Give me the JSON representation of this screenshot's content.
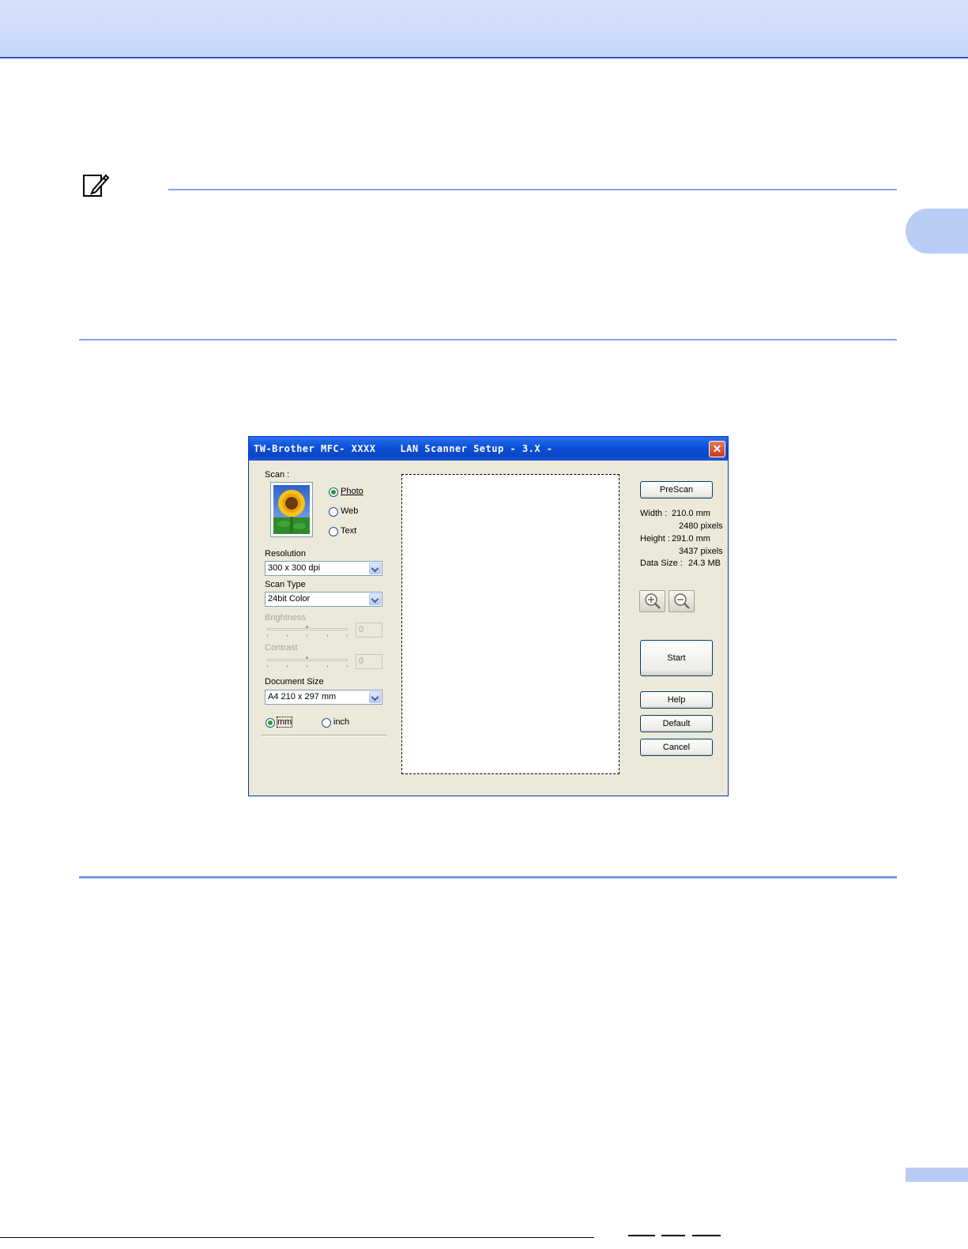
{
  "dialog": {
    "title": "TW-Brother MFC- XXXX    LAN Scanner Setup - 3.X -",
    "close_label": "✕",
    "scan": {
      "label": "Scan :",
      "options": [
        "Photo",
        "Web",
        "Text"
      ],
      "selected": "Photo"
    },
    "resolution": {
      "label": "Resolution",
      "value": "300 x 300 dpi"
    },
    "scan_type": {
      "label": "Scan Type",
      "value": "24bit Color"
    },
    "brightness": {
      "label": "Brightness",
      "value": "0"
    },
    "contrast": {
      "label": "Contrast",
      "value": "0"
    },
    "document_size": {
      "label": "Document Size",
      "value": "A4 210 x 297 mm"
    },
    "units": {
      "options": [
        "mm",
        "inch"
      ],
      "selected": "mm"
    },
    "buttons": {
      "prescan": "PreScan",
      "start": "Start",
      "help": "Help",
      "default": "Default",
      "cancel": "Cancel"
    },
    "info": {
      "width_label": "Width :",
      "width_mm": "210.0 mm",
      "width_px": "2480 pixels",
      "height_label": "Height :",
      "height_mm": "291.0 mm",
      "height_px": "3437 pixels",
      "datasize_label": "Data Size :",
      "datasize": "24.3 MB"
    },
    "colors": {
      "titlebar": "#0a46c8",
      "face": "#ece9d8"
    }
  }
}
